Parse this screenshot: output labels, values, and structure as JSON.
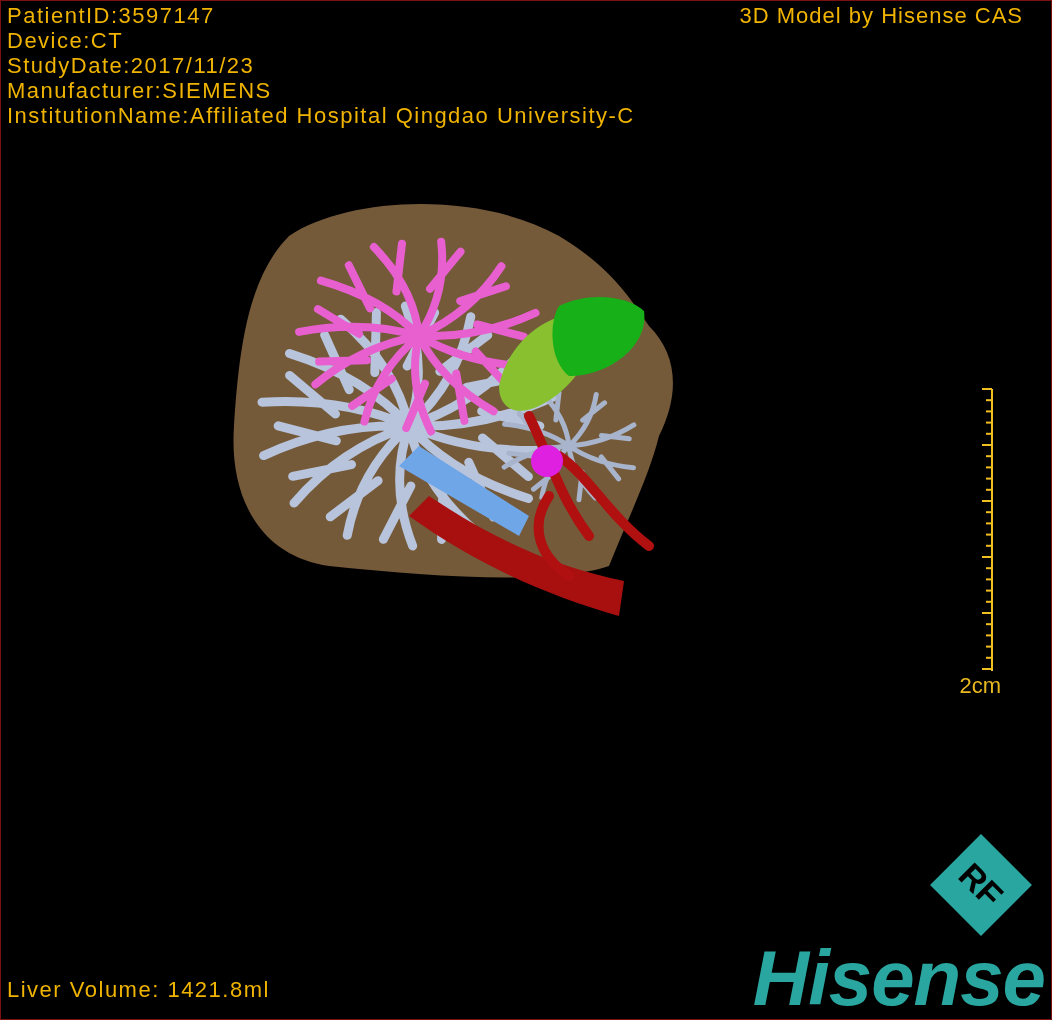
{
  "info_lines": [
    "PatientID:3597147",
    "Device:CT",
    "StudyDate:2017/11/23",
    "Manufacturer:SIEMENS",
    "InstitutionName:Affiliated Hospital Qingdao University-C"
  ],
  "title_right": "3D Model by Hisense CAS",
  "scale_bar": {
    "label": "2cm"
  },
  "liver_volume": "Liver Volume: 1421.8ml",
  "logo": {
    "badge": "RF",
    "wordmark": "Hisense"
  }
}
